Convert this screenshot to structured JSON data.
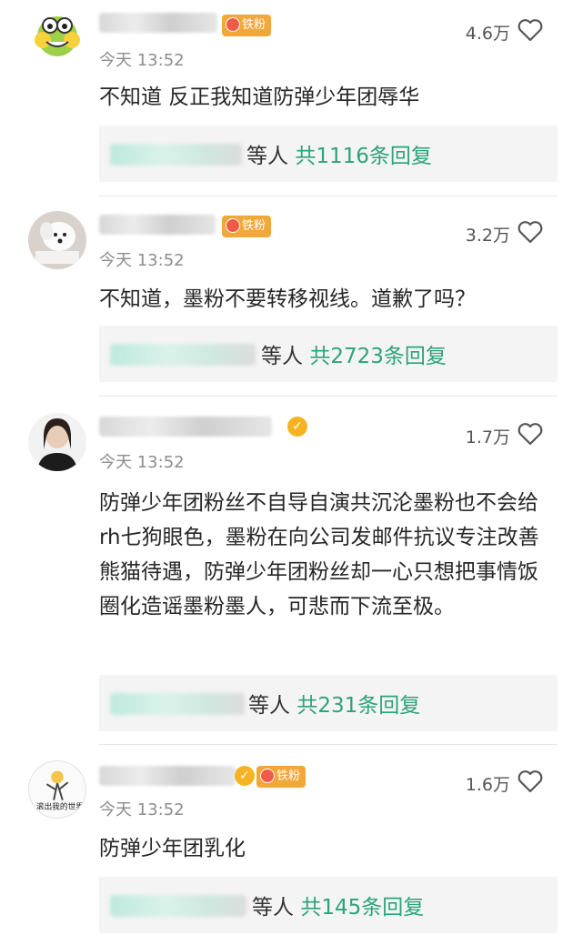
{
  "comments": [
    {
      "badge": "铁粉",
      "likes": "4.6万",
      "time": "今天 13:52",
      "text": "不知道 反正我知道防弹少年团辱华",
      "reply_suffix": "等人 ",
      "reply_count": "共1116条回复",
      "avatar_icon": "frog-avatar-icon"
    },
    {
      "badge": "铁粉",
      "likes": "3.2万",
      "time": "今天 13:52",
      "text": "不知道，墨粉不要转移视线。道歉了吗？",
      "reply_suffix": "等人 ",
      "reply_count": "共2723条回复",
      "avatar_icon": "dog-avatar-icon"
    },
    {
      "badge": "",
      "likes": "1.7万",
      "time": "今天 13:52",
      "text": "防弹少年团粉丝不自导自演共沉沦墨粉也不会给rh七狗眼色，墨粉在向公司发邮件抗议专注改善熊猫待遇，防弹少年团粉丝却一心只想把事情饭圈化造谣墨粉墨人，可悲而下流至极。",
      "reply_suffix": "等人 ",
      "reply_count": "共231条回复",
      "avatar_icon": "person-avatar-icon"
    },
    {
      "badge": "铁粉",
      "likes": "1.6万",
      "time": "今天 13:52",
      "text": "防弹少年团乳化",
      "reply_suffix": "等人 ",
      "reply_count": "共145条回复",
      "avatar_icon": "sketch-avatar-icon"
    }
  ],
  "colors": {
    "reply_count": "#2ca37a",
    "badge": "#f2a73b",
    "verified": "#f5b323"
  }
}
